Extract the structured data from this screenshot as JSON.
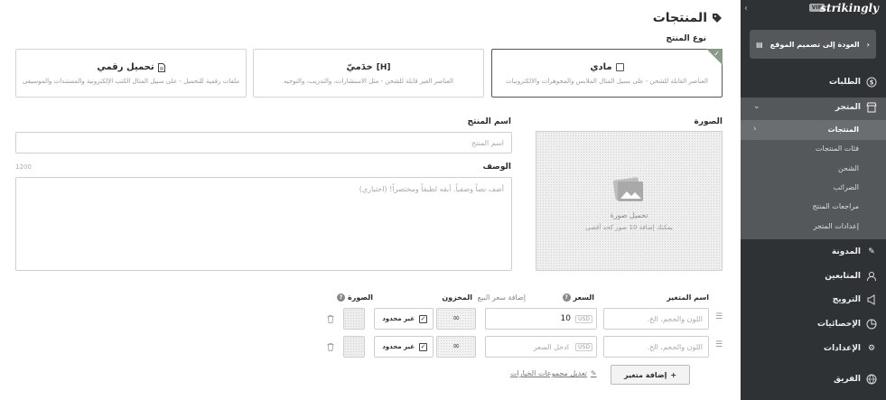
{
  "page": {
    "title": "المنتجات",
    "product_type_label": "نوع المنتج"
  },
  "product_types": [
    {
      "key": "physical",
      "title": "مادي",
      "desc": "العناصر القابلة للشحن - على سبيل المثال الملابس والمجوهرات والالكترونيات",
      "selected": true
    },
    {
      "key": "service",
      "title": "خدَميّ",
      "desc": "العناصر الغير قابلة للشحن - مثل الاستشارات، والتدريب، والتوجيه",
      "selected": false
    },
    {
      "key": "digital",
      "title": "تحميل رقمي",
      "desc": "ملفات رقمية للتحميل - على سبيل المثال الكتب الإلكترونية والمستندات والموسيقى",
      "selected": false
    }
  ],
  "form": {
    "image_label": "الصورة",
    "upload_title": "تحميل صورة",
    "upload_hint": "يمكنك إضافة 10 صور كحد أقصى",
    "name_label": "اسم المنتج",
    "name_placeholder": "اسم المنتج",
    "desc_label": "الوصف",
    "desc_counter": "1200",
    "desc_placeholder": "أضف نصاً وصفياً. أبقه لطيفاً ومختصراً! (اختياري)"
  },
  "variants": {
    "headers": {
      "name": "اسم المتغير",
      "price": "السعر",
      "sale": "إضافة سعر البيع",
      "stock": "المخزون",
      "image": "الصورة"
    },
    "rows": [
      {
        "name_placeholder": "اللون والحجم، الخ.",
        "price": "10",
        "price_placeholder": "",
        "currency": "USD",
        "stock_symbol": "∞",
        "unlimited": "غير محدود"
      },
      {
        "name_placeholder": "اللون والحجم، الخ.",
        "price": "",
        "price_placeholder": "ادخل السعر",
        "currency": "USD",
        "stock_symbol": "∞",
        "unlimited": "غير محدود"
      }
    ],
    "add_button": "إضافة متغير",
    "edit_groups_link": "تعديل مجموعات الخيارات"
  },
  "sidebar": {
    "brand": "strikingly",
    "vip_badge": "VIP",
    "back_button": "العودة إلى تصميم الموقع",
    "nav": {
      "orders": "الطلبات",
      "store": "المتجر",
      "blog": "المدونة",
      "followers": "المتابعين",
      "promotion": "الترويج",
      "analytics": "الإحصائيات",
      "settings": "الإعدادات",
      "team": "الفريق"
    },
    "store_sub": {
      "products": "المنتجات",
      "categories": "فئات المنتجات",
      "shipping": "الشحن",
      "taxes": "الضرائب",
      "reviews": "مراجعات المنتج",
      "store_settings": "إعدادات المتجر"
    }
  },
  "colors": {
    "sidebar_bg": "#2f3234",
    "sidebar_active": "#54585b",
    "accent_corner": "#8a9a8a"
  }
}
